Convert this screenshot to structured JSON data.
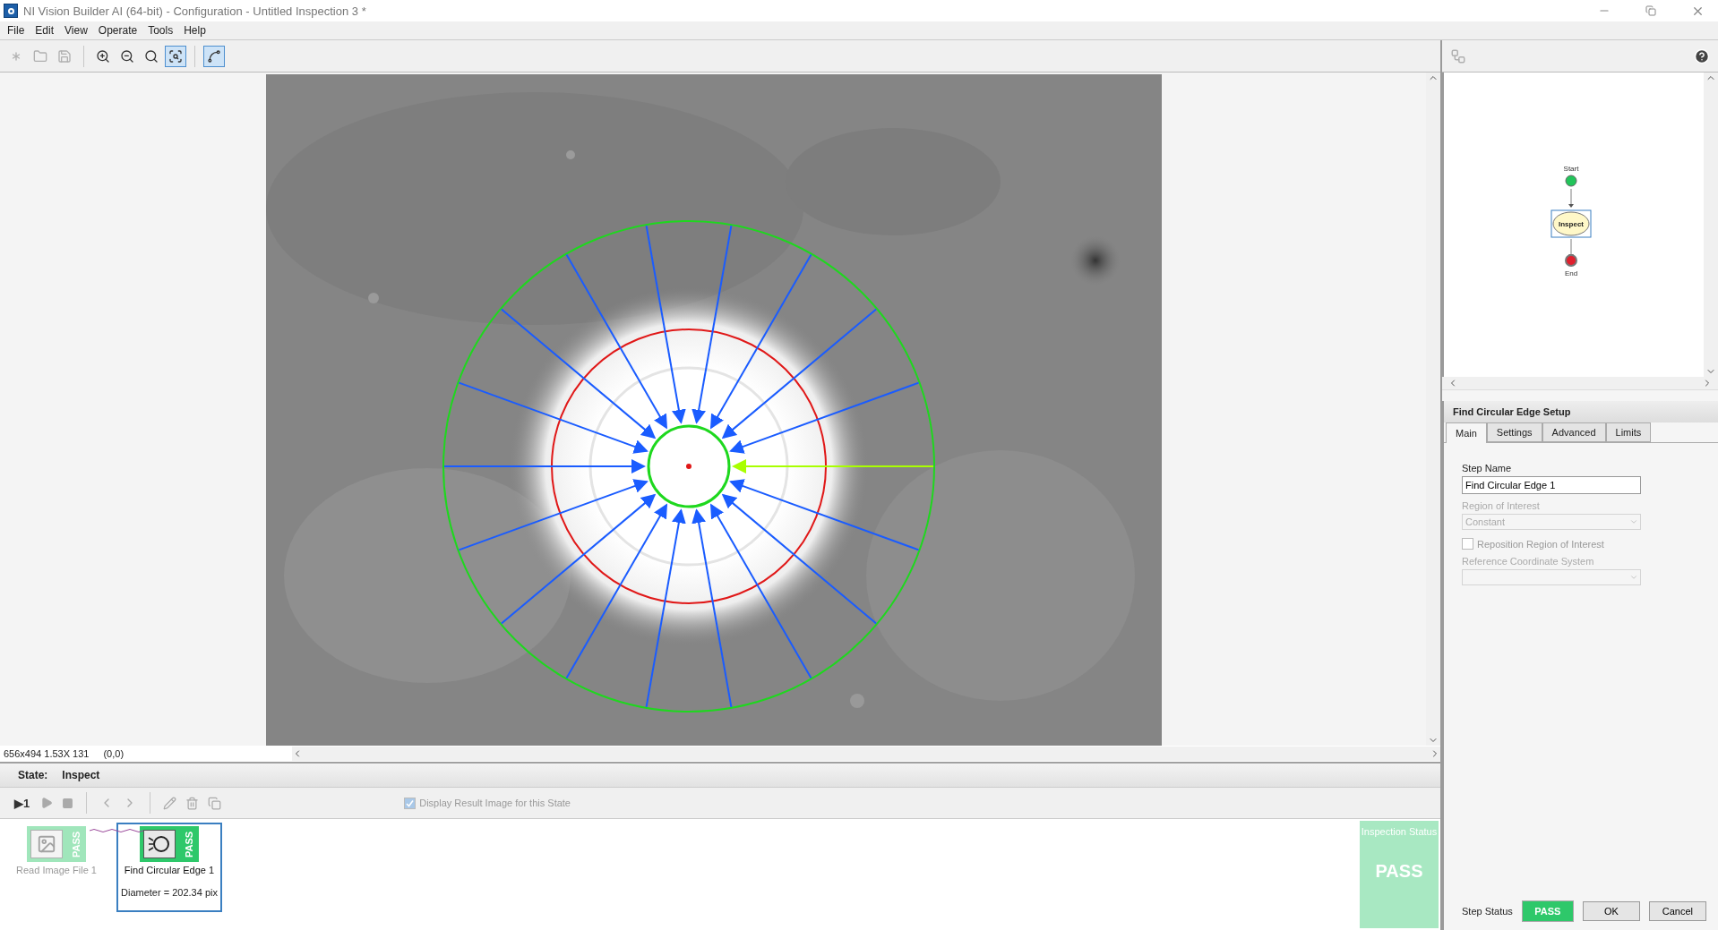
{
  "window": {
    "title": "NI Vision Builder AI (64-bit) - Configuration - Untitled Inspection 3 *"
  },
  "menu": [
    "File",
    "Edit",
    "View",
    "Operate",
    "Tools",
    "Help"
  ],
  "toolbar": [
    {
      "kind": "new",
      "disabled": true,
      "pressed": false
    },
    {
      "kind": "open",
      "disabled": true,
      "pressed": false
    },
    {
      "kind": "save",
      "disabled": true,
      "pressed": false
    },
    {
      "kind": "zoom-in",
      "disabled": false,
      "pressed": false
    },
    {
      "kind": "zoom-out",
      "disabled": false,
      "pressed": false
    },
    {
      "kind": "zoom-actual",
      "disabled": false,
      "pressed": false
    },
    {
      "kind": "zoom-fit",
      "disabled": false,
      "pressed": true
    },
    {
      "kind": "roi",
      "disabled": false,
      "pressed": true
    }
  ],
  "image_info": {
    "size": "656x494 1.53X 131",
    "position": "(0,0)"
  },
  "state": {
    "label": "State:",
    "value": "Inspect"
  },
  "run_once": "▶1",
  "display_result": {
    "label": "Display Result Image for this State",
    "checked": true
  },
  "steps": [
    {
      "name": "Read Image File 1",
      "status": "PASS",
      "kind": "read-image",
      "selected": false
    },
    {
      "name": "Find Circular Edge 1",
      "status": "PASS",
      "kind": "circular-edge",
      "selected": true,
      "result": "Diameter = 202.34 pix"
    }
  ],
  "inspection_status": {
    "title": "Inspection Status",
    "value": "PASS"
  },
  "flow": {
    "nodes": [
      {
        "kind": "start",
        "label": "Start"
      },
      {
        "kind": "state",
        "label": "Inspect",
        "selected": true
      },
      {
        "kind": "end",
        "label": "End"
      }
    ]
  },
  "setup": {
    "title": "Find Circular Edge Setup",
    "tabs": [
      {
        "label": "Main",
        "selected": true
      },
      {
        "label": "Settings",
        "selected": false
      },
      {
        "label": "Advanced",
        "selected": false
      },
      {
        "label": "Limits",
        "selected": false
      }
    ],
    "fields": [
      {
        "kind": "text",
        "label": "Step Name",
        "value": "Find Circular Edge 1",
        "disabled": false
      },
      {
        "kind": "select",
        "label": "Region of Interest",
        "value": "Constant",
        "disabled": true
      },
      {
        "kind": "checkbox",
        "label": "Reposition Region of Interest",
        "checked": false,
        "disabled": true
      },
      {
        "kind": "select",
        "label": "Reference Coordinate System",
        "disabled": true
      }
    ]
  },
  "footer": {
    "step_status_label": "Step Status",
    "step_status": "PASS",
    "buttons": [
      "OK",
      "Cancel"
    ]
  }
}
